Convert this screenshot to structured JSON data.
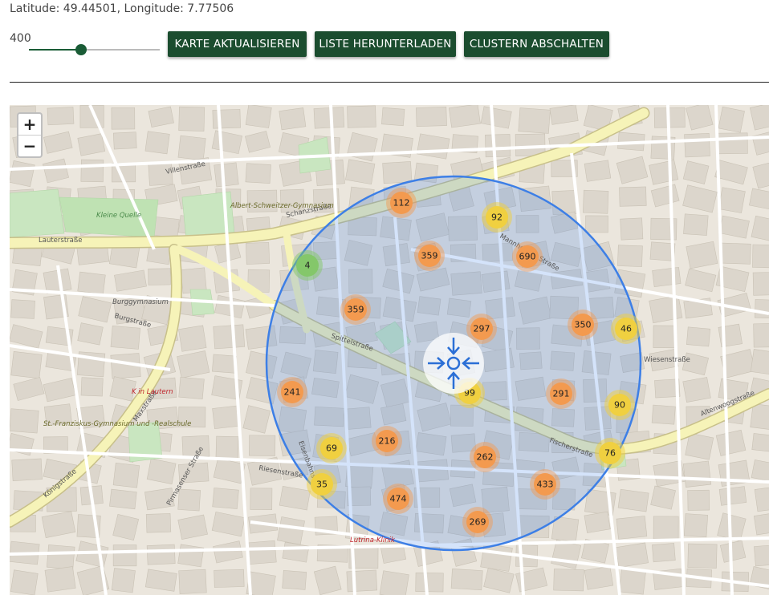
{
  "coords_text": "Latitude: 49.44501, Longitude: 7.77506",
  "slider": {
    "value": "400",
    "fraction": 0.4
  },
  "buttons": {
    "refresh": "KARTE AKTUALISIEREN",
    "download": "LISTE HERUNTERLADEN",
    "cluster": "CLUSTERN ABSCHALTEN"
  },
  "zoom": {
    "in": "+",
    "out": "−"
  },
  "colors": {
    "button": "#1b4d2f",
    "circle": "#3d7fe6",
    "orange": "#f39a4f",
    "yellow": "#f0d040",
    "green": "#84c76a"
  },
  "clusters": [
    {
      "label": "112",
      "color": "orange"
    },
    {
      "label": "92",
      "color": "yellow"
    },
    {
      "label": "359",
      "color": "orange"
    },
    {
      "label": "690",
      "color": "orange"
    },
    {
      "label": "4",
      "color": "green"
    },
    {
      "label": "359",
      "color": "orange"
    },
    {
      "label": "297",
      "color": "orange"
    },
    {
      "label": "350",
      "color": "orange"
    },
    {
      "label": "46",
      "color": "yellow"
    },
    {
      "label": "241",
      "color": "orange"
    },
    {
      "label": "99",
      "color": "yellow"
    },
    {
      "label": "291",
      "color": "orange"
    },
    {
      "label": "90",
      "color": "yellow"
    },
    {
      "label": "216",
      "color": "orange"
    },
    {
      "label": "69",
      "color": "yellow"
    },
    {
      "label": "262",
      "color": "orange"
    },
    {
      "label": "76",
      "color": "yellow"
    },
    {
      "label": "35",
      "color": "yellow"
    },
    {
      "label": "474",
      "color": "orange"
    },
    {
      "label": "433",
      "color": "orange"
    },
    {
      "label": "269",
      "color": "orange"
    }
  ],
  "streets": [
    "Lauterstraße",
    "Villenstraße",
    "Burgstraße",
    "Spittelstraße",
    "Fischerstraße",
    "Altenwoogstraße",
    "Maxstraße",
    "Königstraße",
    "Mannheimer Straße",
    "Schanzstraße",
    "Wiesenstraße",
    "Eisenbahnstraße",
    "Riesenstraße",
    "Pirmasenser Straße"
  ],
  "places": [
    "Albert-Schweitzer-Gymnasium",
    "Burggymnasium",
    "Lutrina-Klinik",
    "St.-Franziskus-Gymnasium und -Realschule",
    "Kleine Quelle",
    "K in Lautern"
  ]
}
